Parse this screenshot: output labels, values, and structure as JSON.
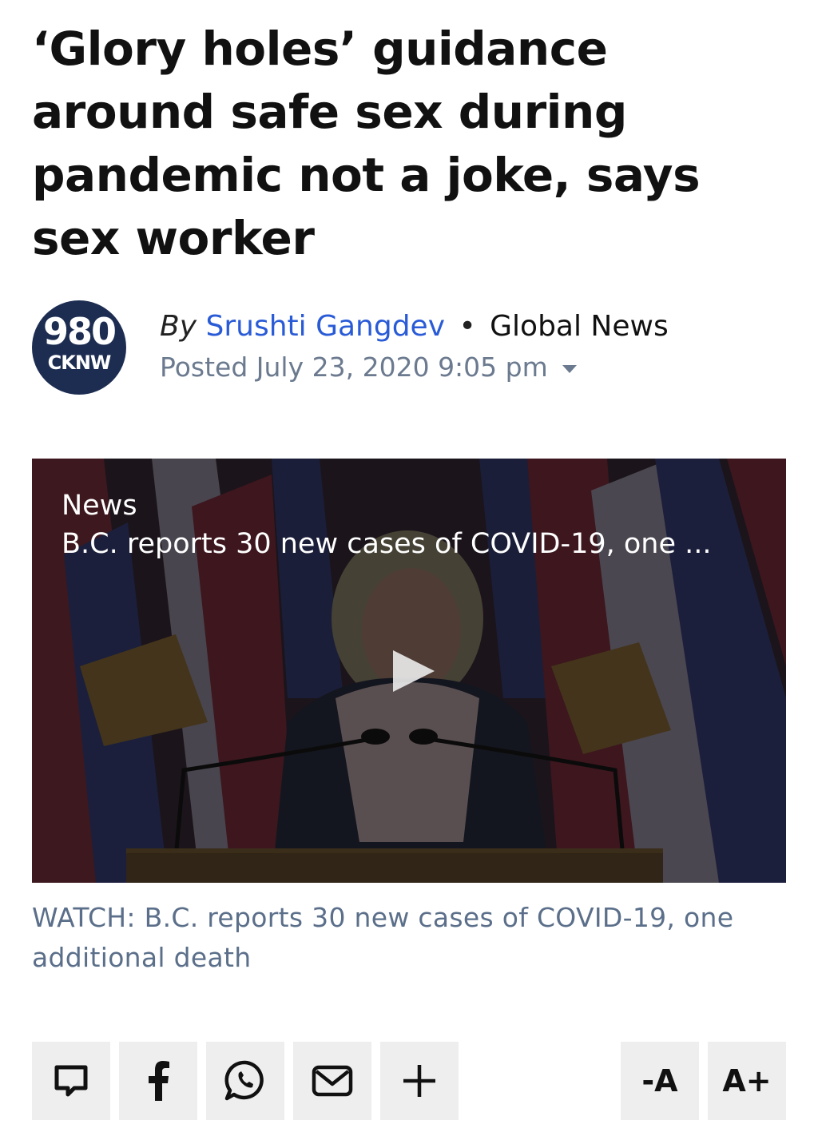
{
  "article": {
    "headline": "‘Glory holes’ guidance around safe sex during pandemic not a joke, says sex worker",
    "logo": {
      "number": "980",
      "call_letters": "CKNW"
    },
    "byline": {
      "by_label": "By",
      "author": "Srushti Gangdev",
      "separator": "•",
      "source": "Global News"
    },
    "posted": "Posted July 23, 2020 9:05 pm"
  },
  "video": {
    "category": "News",
    "title": "B.C. reports 30 new cases of COVID-19, one ..."
  },
  "caption": "WATCH: B.C. reports 30 new cases of COVID-19, one additional death",
  "toolbar": {
    "buttons": [
      {
        "icon": "comment-icon"
      },
      {
        "icon": "facebook-icon"
      },
      {
        "icon": "whatsapp-icon"
      },
      {
        "icon": "email-icon"
      },
      {
        "icon": "plus-icon"
      }
    ],
    "decrease_font_label": "-A",
    "increase_font_label": "A+"
  },
  "colors": {
    "author_link": "#2a5bd7",
    "meta_text": "#6b7a8f",
    "caption_text": "#5b6f8a",
    "logo_bg": "#1d2d52",
    "toolbar_bg": "#eeeeee"
  }
}
